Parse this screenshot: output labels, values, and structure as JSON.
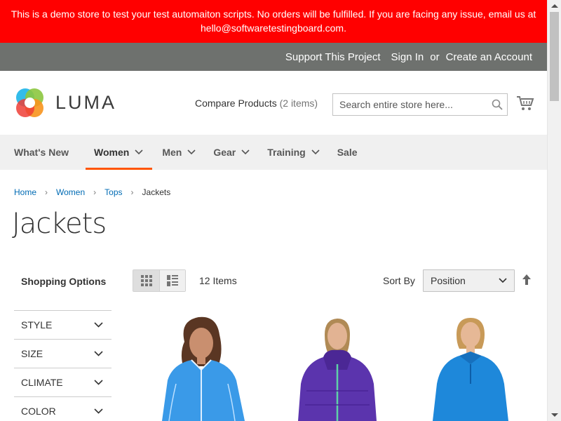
{
  "notice": {
    "text": "This is a demo store to test your test automaiton scripts. No orders will be fulfilled. If you are facing any issue, email us at hello@softwaretestingboard.com."
  },
  "topbar": {
    "support": "Support This Project",
    "signin": "Sign In",
    "or": "or",
    "create": "Create an Account"
  },
  "header": {
    "logo_text": "LUMA",
    "compare_label": "Compare Products",
    "compare_count": "(2 items)",
    "search_placeholder": "Search entire store here...",
    "icons": {
      "search": "search-icon",
      "cart": "cart-icon"
    }
  },
  "nav": {
    "items": [
      {
        "label": "What's New",
        "has_menu": false
      },
      {
        "label": "Women",
        "has_menu": true,
        "active": true
      },
      {
        "label": "Men",
        "has_menu": true
      },
      {
        "label": "Gear",
        "has_menu": true
      },
      {
        "label": "Training",
        "has_menu": true
      },
      {
        "label": "Sale",
        "has_menu": false
      }
    ]
  },
  "breadcrumb": {
    "items": [
      "Home",
      "Women",
      "Tops"
    ],
    "current": "Jackets"
  },
  "page_title": "Jackets",
  "sidebar": {
    "title": "Shopping Options",
    "filters": [
      "STYLE",
      "SIZE",
      "CLIMATE",
      "COLOR"
    ]
  },
  "toolbar": {
    "count_text": "12 Items",
    "sort_label": "Sort By",
    "sort_value": "Position",
    "modes": [
      "grid-view-icon",
      "list-view-icon"
    ],
    "active_mode": "grid"
  },
  "products": [
    {
      "color": "#2f8fe0"
    },
    {
      "color": "#5a33a8"
    },
    {
      "color": "#1f86d9"
    }
  ],
  "colors": {
    "notice_bg": "#ff0000",
    "topbar_bg": "#6e716e",
    "nav_bg": "#f0f0f0",
    "accent": "#ff5501",
    "link": "#006bb4"
  }
}
